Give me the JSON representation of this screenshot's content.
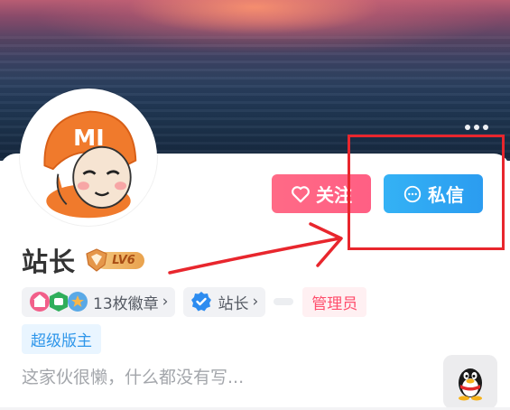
{
  "profile": {
    "name": "站长",
    "level_label": "LV6",
    "follow_label": "关注",
    "message_label": "私信",
    "bio": "这家伙很懒，什么都没有写..."
  },
  "tags": {
    "medals_label": "13枚徽章",
    "verify_label": "站长",
    "role_admin": "管理员",
    "role_super_mod": "超级版主",
    "chevron": "›"
  },
  "avatar_text": "MI",
  "icons": {
    "more": "more-horizontal-icon",
    "follow": "heart-outline-icon",
    "message": "chat-bubble-icon",
    "verify": "verified-check-icon",
    "qq": "qq-penguin-icon"
  },
  "colors": {
    "follow_button": "#ff6a86",
    "message_button": "#34b2f5",
    "annotation_red": "#e8262d",
    "admin_tag": "#ff4f6d",
    "super_mod_tag": "#2e96ea"
  }
}
